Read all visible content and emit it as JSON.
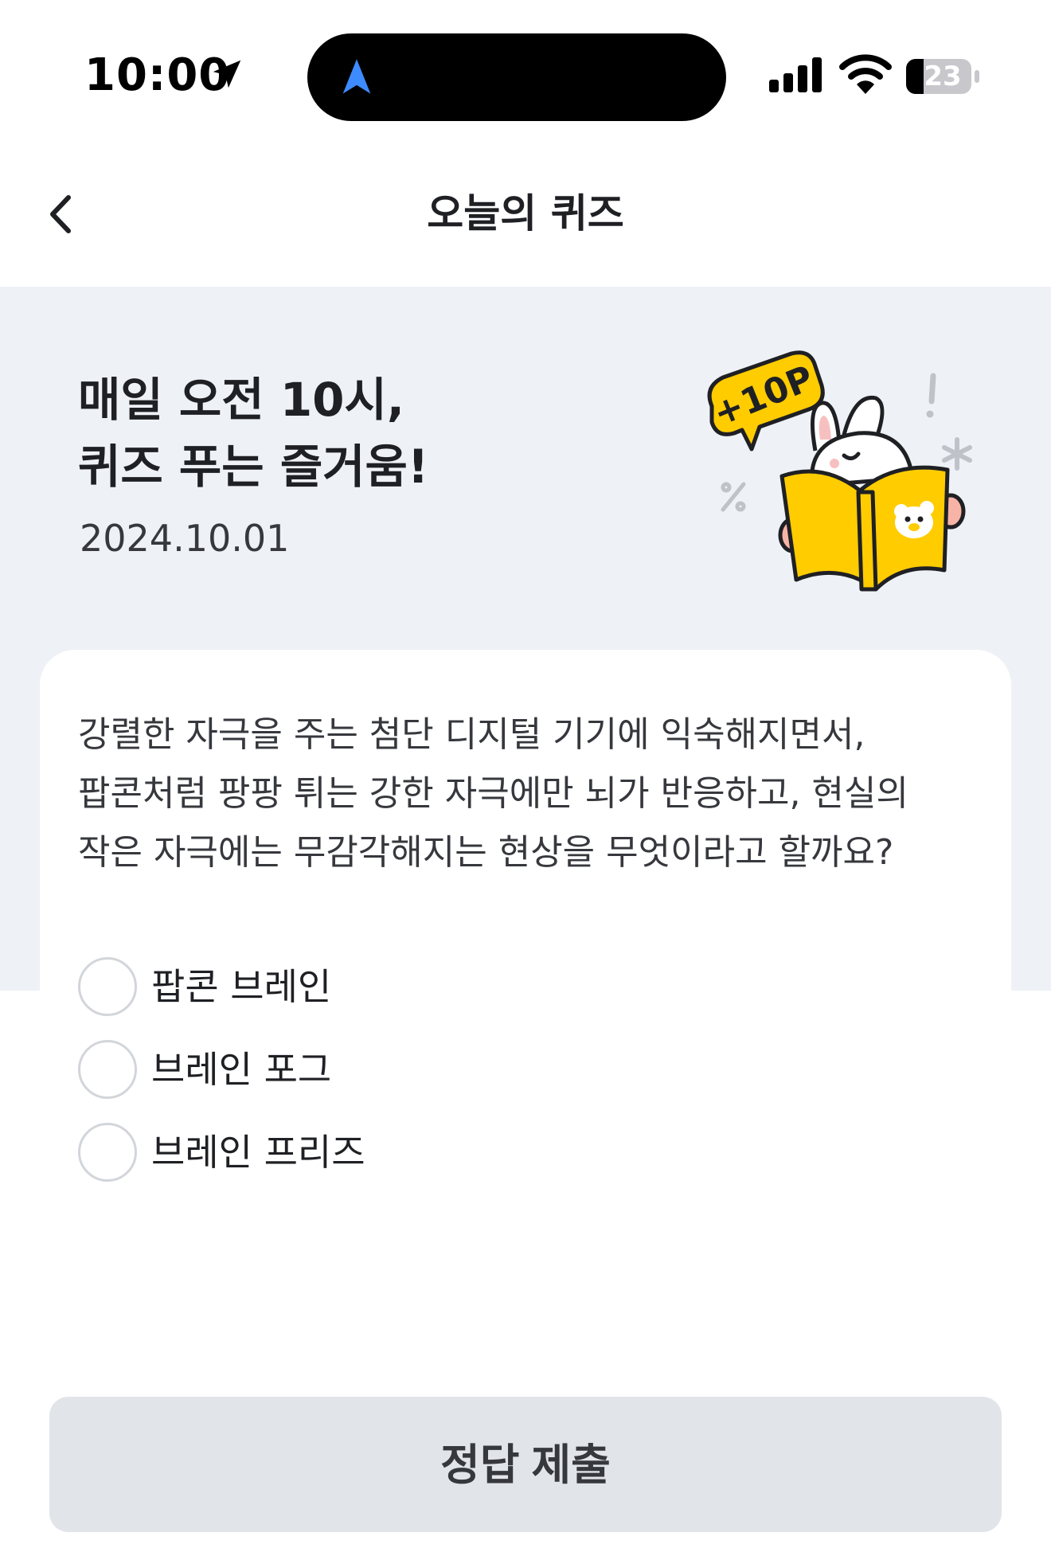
{
  "status_bar": {
    "time": "10:00",
    "battery_level": "23",
    "icons": [
      "location-arrow-icon",
      "navigation-icon",
      "cellular-signal-icon",
      "wifi-icon",
      "battery-icon"
    ]
  },
  "header": {
    "title": "오늘의 퀴즈",
    "back_icon": "chevron-left-icon"
  },
  "hero": {
    "headline_line1": "매일 오전 10시,",
    "headline_line2": "퀴즈 푸는 즐거움!",
    "date": "2024.10.01",
    "points_badge": "+10P",
    "illustration": "rabbit-reading-book-illustration"
  },
  "quiz": {
    "question": "강렬한 자극을 주는 첨단 디지털 기기에 익숙해지면서, 팝콘처럼 팡팡 튀는 강한 자극에만 뇌가 반응하고, 현실의 작은 자극에는 무감각해지는 현상을 무엇이라고 할까요?",
    "options": [
      {
        "label": "팝콘 브레인",
        "selected": false
      },
      {
        "label": "브레인 포그",
        "selected": false
      },
      {
        "label": "브레인 프리즈",
        "selected": false
      }
    ]
  },
  "submit": {
    "label": "정답 제출"
  },
  "colors": {
    "hero_background": "#eef1f5",
    "accent_yellow": "#ffcc00",
    "text_primary": "#1f2024",
    "button_disabled": "#e1e4e8",
    "nav_blue": "#3d8bff"
  }
}
